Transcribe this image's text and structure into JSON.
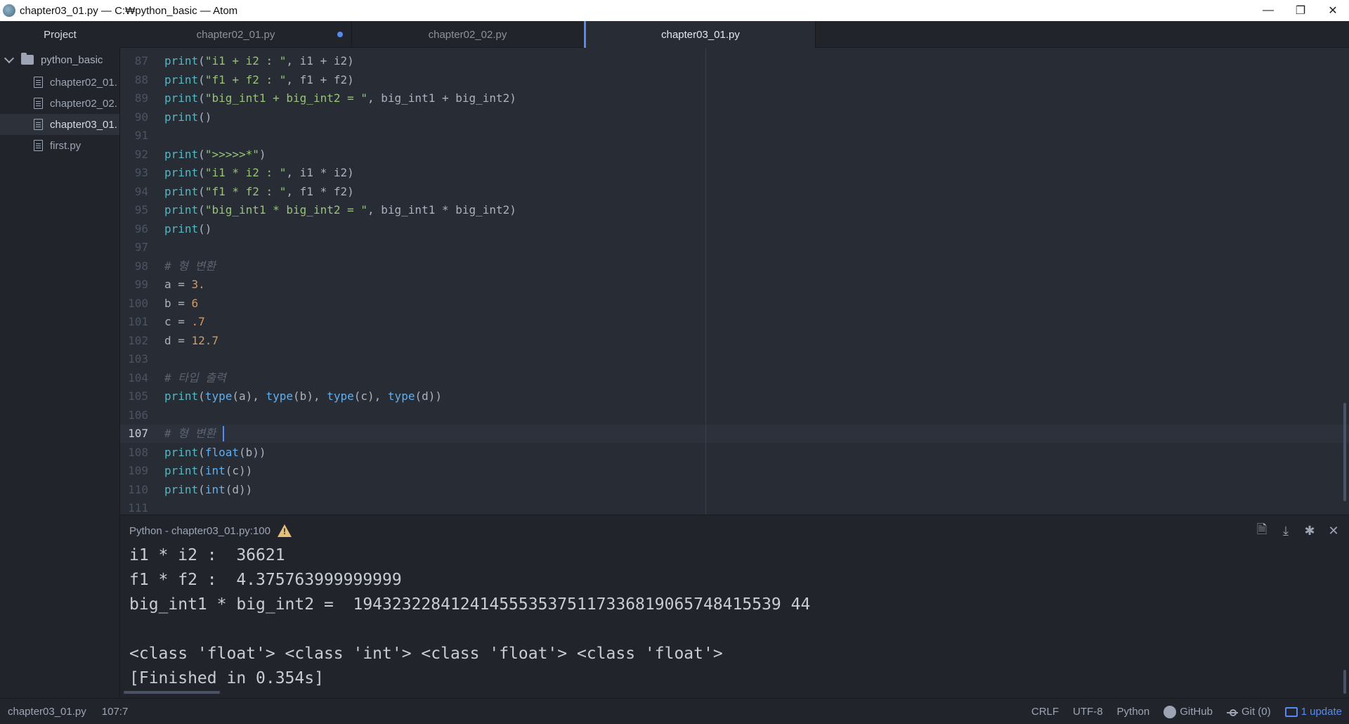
{
  "window": {
    "title": "chapter03_01.py — C:₩python_basic — Atom",
    "controls": {
      "minimize": "—",
      "restore": "❐",
      "close": "✕"
    }
  },
  "sidebar": {
    "header": "Project",
    "root": "python_basic",
    "items": [
      {
        "label": "chapter02_01."
      },
      {
        "label": "chapter02_02."
      },
      {
        "label": "chapter03_01."
      },
      {
        "label": "first.py"
      }
    ]
  },
  "tabs": [
    {
      "label": "chapter02_01.py",
      "modified": true
    },
    {
      "label": "chapter02_02.py",
      "modified": false
    },
    {
      "label": "chapter03_01.py",
      "modified": false,
      "active": true
    }
  ],
  "editor": {
    "lines": [
      {
        "n": "87",
        "html": "<span class=\"kw\">print</span>(<span class=\"str\">\"i1 + i2 : \"</span>, i1 + i2)"
      },
      {
        "n": "88",
        "html": "<span class=\"kw\">print</span>(<span class=\"str\">\"f1 + f2 : \"</span>, f1 + f2)"
      },
      {
        "n": "89",
        "html": "<span class=\"kw\">print</span>(<span class=\"str\">\"big_int1 + big_int2 = \"</span>, big_int1 + big_int2)"
      },
      {
        "n": "90",
        "html": "<span class=\"kw\">print</span>()"
      },
      {
        "n": "91",
        "html": ""
      },
      {
        "n": "92",
        "html": "<span class=\"kw\">print</span>(<span class=\"str\">\">>>>>*\"</span>)"
      },
      {
        "n": "93",
        "html": "<span class=\"kw\">print</span>(<span class=\"str\">\"i1 * i2 : \"</span>, i1 * i2)"
      },
      {
        "n": "94",
        "html": "<span class=\"kw\">print</span>(<span class=\"str\">\"f1 * f2 : \"</span>, f1 * f2)"
      },
      {
        "n": "95",
        "html": "<span class=\"kw\">print</span>(<span class=\"str\">\"big_int1 * big_int2 = \"</span>, big_int1 * big_int2)"
      },
      {
        "n": "96",
        "html": "<span class=\"kw\">print</span>()"
      },
      {
        "n": "97",
        "html": ""
      },
      {
        "n": "98",
        "html": "<span class=\"com\"># 형 변환</span>"
      },
      {
        "n": "99",
        "html": "a = <span class=\"num\">3.</span>"
      },
      {
        "n": "100",
        "html": "b = <span class=\"num\">6</span>"
      },
      {
        "n": "101",
        "html": "c = <span class=\"num\">.7</span>"
      },
      {
        "n": "102",
        "html": "d = <span class=\"num\">12.7</span>"
      },
      {
        "n": "103",
        "html": ""
      },
      {
        "n": "104",
        "html": "<span class=\"com\"># 타입 출력</span>"
      },
      {
        "n": "105",
        "html": "<span class=\"kw\">print</span>(<span class=\"fn\">type</span>(a), <span class=\"fn\">type</span>(b), <span class=\"fn\">type</span>(c), <span class=\"fn\">type</span>(d))"
      },
      {
        "n": "106",
        "html": ""
      },
      {
        "n": "107",
        "html": "<span class=\"com\"># 형 변환</span>",
        "current": true
      },
      {
        "n": "108",
        "html": "<span class=\"kw\">print</span>(<span class=\"fn\">float</span>(b))"
      },
      {
        "n": "109",
        "html": "<span class=\"kw\">print</span>(<span class=\"fn\">int</span>(c))"
      },
      {
        "n": "110",
        "html": "<span class=\"kw\">print</span>(<span class=\"fn\">int</span>(d))"
      },
      {
        "n": "111",
        "html": ""
      }
    ]
  },
  "panel": {
    "title": "Python - chapter03_01.py:100",
    "output": [
      "i1 * i2 :  36621",
      "f1 * f2 :  4.375763999999999",
      "big_int1 * big_int2 =  19432322841241455535375117336819065748415539 44",
      "",
      "<class 'float'> <class 'int'> <class 'float'> <class 'float'>",
      "[Finished in 0.354s]"
    ]
  },
  "statusbar": {
    "file": "chapter03_01.py",
    "position": "107:7",
    "line_ending": "CRLF",
    "encoding": "UTF-8",
    "grammar": "Python",
    "github": "GitHub",
    "git": "Git (0)",
    "update": "1 update"
  }
}
